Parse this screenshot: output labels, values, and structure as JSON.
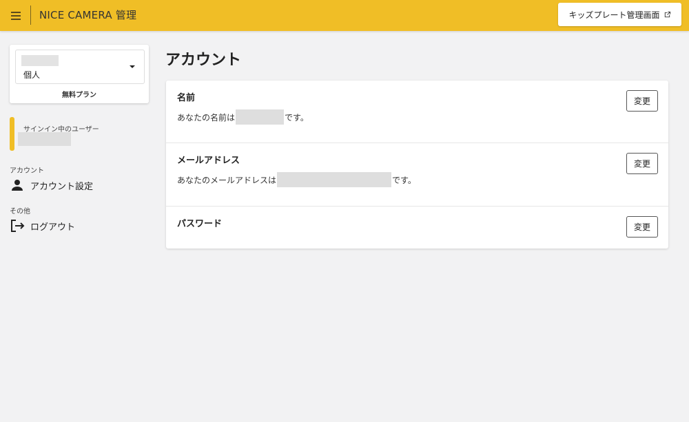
{
  "header": {
    "app_title": "NICE CAMERA 管理",
    "kids_button_label": "キッズプレート管理画面"
  },
  "sidebar": {
    "plan_type": "個人",
    "plan_label": "無料プラン",
    "signin_label": "サインイン中のユーザー",
    "sections": [
      {
        "label": "アカウント",
        "items": [
          {
            "label": "アカウント設定",
            "icon": "person-icon"
          }
        ]
      },
      {
        "label": "その他",
        "items": [
          {
            "label": "ログアウト",
            "icon": "logout-icon"
          }
        ]
      }
    ]
  },
  "main": {
    "title": "アカウント",
    "rows": [
      {
        "title": "名前",
        "desc_prefix": "あなたの名前は",
        "desc_suffix": "です。",
        "button": "変更"
      },
      {
        "title": "メールアドレス",
        "desc_prefix": "あなたのメールアドレスは",
        "desc_suffix": "です。",
        "button": "変更"
      },
      {
        "title": "パスワード",
        "button": "変更"
      }
    ]
  },
  "colors": {
    "accent": "#f0be26",
    "background": "#f2f2f3"
  }
}
